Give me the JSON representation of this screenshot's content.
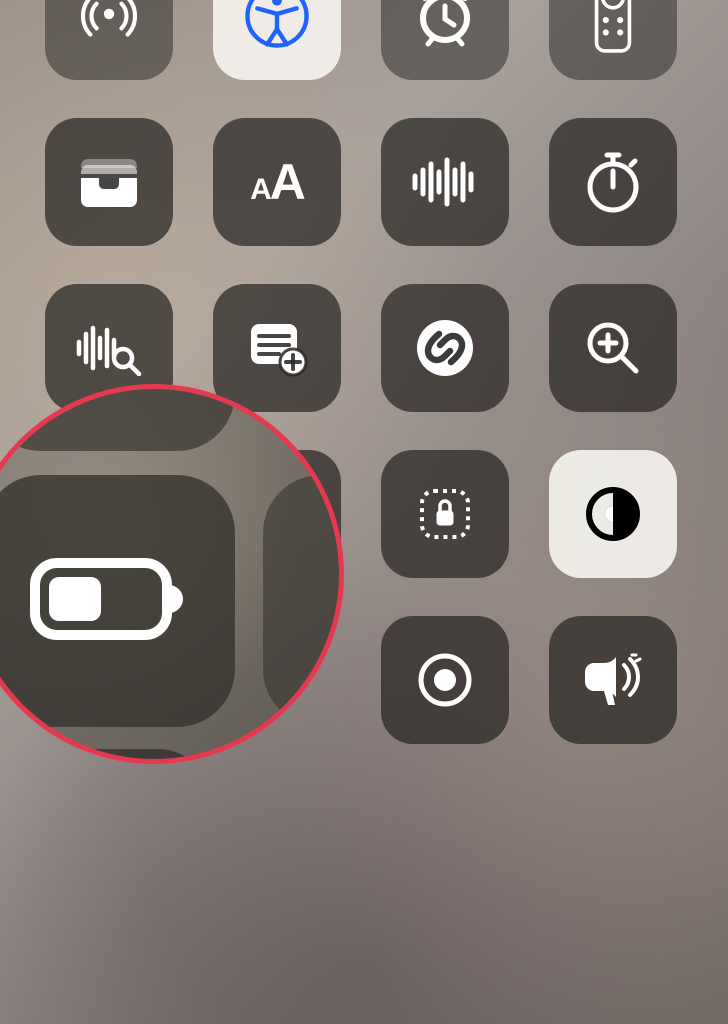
{
  "tiles": {
    "airdrop": {
      "name": "airdrop-icon"
    },
    "accessibility": {
      "name": "accessibility-icon"
    },
    "alarm": {
      "name": "alarm-icon"
    },
    "remote": {
      "name": "apple-tv-remote-icon"
    },
    "wallet": {
      "name": "wallet-icon"
    },
    "textsize": {
      "name": "text-size-icon",
      "label": "AA"
    },
    "voicememo": {
      "name": "voice-memos-icon"
    },
    "stopwatch": {
      "name": "stopwatch-icon"
    },
    "soundrec": {
      "name": "sound-recognition-icon"
    },
    "quicknote": {
      "name": "quick-note-icon"
    },
    "shazam": {
      "name": "shazam-icon"
    },
    "magnifier": {
      "name": "magnifier-icon"
    },
    "hearing": {
      "name": "hearing-icon"
    },
    "guidedaccess": {
      "name": "guided-access-icon"
    },
    "darkmode": {
      "name": "dark-mode-icon"
    },
    "screenrecord": {
      "name": "screen-recording-icon"
    },
    "announce": {
      "name": "announce-notifications-icon"
    }
  },
  "highlight": {
    "low_power_mode": {
      "name": "low-power-mode-icon"
    }
  },
  "annotation": {
    "circle_color": "#e63950"
  }
}
